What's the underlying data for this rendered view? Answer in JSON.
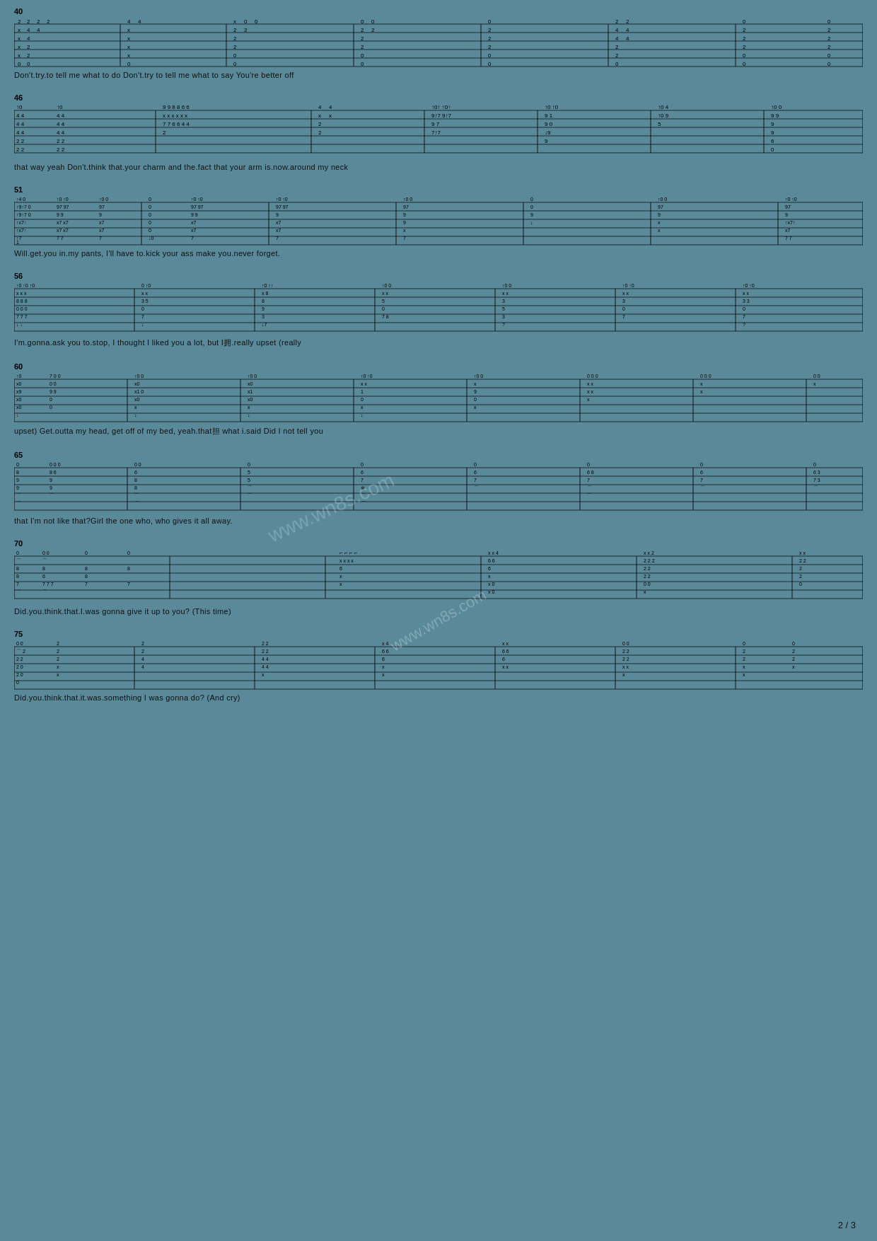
{
  "page": {
    "number": "2 / 3",
    "watermark": "www.wn8s.com",
    "background_color": "#5a8a9a"
  },
  "sections": [
    {
      "id": "section-40",
      "measure_start": 40,
      "lyrics": "Don't.try.to  tell  me          what to do   Don't.try to   tell me          what to    say      You're better off"
    },
    {
      "id": "section-46",
      "measure_start": 46,
      "lyrics": "that way      yeah              Don't.think that.your charm    and  the.fact    that your arm    is.now.around my neck"
    },
    {
      "id": "section-51",
      "measure_start": 51,
      "lyrics": "Will.get.you in.my pants,     I'll   have to.kick    your ass    make you.never forget."
    },
    {
      "id": "section-56",
      "measure_start": 56,
      "lyrics": "I'm.gonna.ask you to.stop, I    thought   I     liked you a lot, but     I拥.really upset               (really"
    },
    {
      "id": "section-60",
      "measure_start": 60,
      "lyrics": "upset)  Get.outta my head,     get   off    of    my bed, yeah.that担  what i.said      Did       I      not   tell you"
    },
    {
      "id": "section-65",
      "measure_start": 65,
      "lyrics": "that  I'm          not   like    that?Girl  the   one           who,          who gives    it   all    away."
    },
    {
      "id": "section-70",
      "measure_start": 70,
      "lyrics": "Did.you.think.that.I.was                   gonna give  it  up   to    you?         (This time)"
    },
    {
      "id": "section-75",
      "measure_start": 75,
      "lyrics": "Did.you.think.that.it.was.something       I   was gonna         do?           (And cry)"
    }
  ]
}
